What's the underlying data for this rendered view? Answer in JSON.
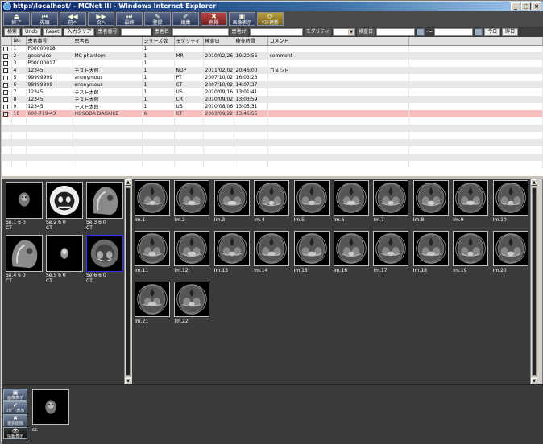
{
  "window": {
    "title": "http://localhost/ - MCNet III - Windows Internet Explorer",
    "min": "_",
    "max": "□",
    "close": "×"
  },
  "toolbar": [
    {
      "label": "終了",
      "icon": "⏏"
    },
    {
      "label": "先頭",
      "icon": "⏮"
    },
    {
      "label": "前へ",
      "icon": "◀◀"
    },
    {
      "label": "次へ",
      "icon": "▶▶"
    },
    {
      "label": "最終",
      "icon": "⏭"
    },
    {
      "label": "登録",
      "icon": "✎"
    },
    {
      "label": "編集",
      "icon": "✐"
    },
    {
      "label": "削除",
      "icon": "✖"
    },
    {
      "label": "画像表示",
      "icon": "▣"
    },
    {
      "label": "ﾘｽﾄ更新",
      "icon": "⟳"
    }
  ],
  "search": {
    "search_btn": "検索",
    "undo_btn": "Undo",
    "reset_btn": "Reset",
    "clear_btn": "入力クリア",
    "patient_id_label": "患者番号",
    "patient_name_label": "患者名",
    "patient_kana_label": "患者ｶﾅ",
    "modality_label": "モダリティ",
    "date_label": "検査日",
    "tilde": "〜",
    "today_btn": "今日",
    "yesterday_btn": "昨日"
  },
  "table": {
    "headers": [
      "",
      "No.",
      "患者番号",
      "患者名",
      "シリーズ数",
      "モダリティ",
      "検査日",
      "検査時間",
      "コメント"
    ],
    "rows": [
      {
        "no": "1",
        "id": "P00000018",
        "name": "",
        "series": "1",
        "modality": "",
        "date": "",
        "time": "",
        "comment": "",
        "checked": false
      },
      {
        "no": "2",
        "id": "geservice",
        "name": "MC phantom",
        "series": "1",
        "modality": "MR",
        "date": "2010/02/26",
        "time": "19:20:55",
        "comment": "comment",
        "checked": false
      },
      {
        "no": "3",
        "id": "P00000017",
        "name": "",
        "series": "1",
        "modality": "",
        "date": "",
        "time": "",
        "comment": "",
        "checked": false
      },
      {
        "no": "4",
        "id": "12345",
        "name": "テスト太郎",
        "series": "1",
        "modality": "NDP",
        "date": "2011/02/02",
        "time": "20:46:00",
        "comment": "コメント",
        "checked": false
      },
      {
        "no": "5",
        "id": "99999999",
        "name": "anonymous",
        "series": "1",
        "modality": "PT",
        "date": "2007/10/02",
        "time": "16:03:23",
        "comment": "",
        "checked": false
      },
      {
        "no": "6",
        "id": "99999999",
        "name": "anonymous",
        "series": "1",
        "modality": "CT",
        "date": "2007/10/02",
        "time": "14:07:37",
        "comment": "",
        "checked": false
      },
      {
        "no": "7",
        "id": "12345",
        "name": "テスト太郎",
        "series": "1",
        "modality": "US",
        "date": "2010/09/16",
        "time": "13:01:41",
        "comment": "",
        "checked": false
      },
      {
        "no": "8",
        "id": "12345",
        "name": "テスト太郎",
        "series": "1",
        "modality": "CR",
        "date": "2010/09/02",
        "time": "13:03:59",
        "comment": "",
        "checked": false
      },
      {
        "no": "9",
        "id": "12345",
        "name": "テスト太郎",
        "series": "1",
        "modality": "US",
        "date": "2010/08/06",
        "time": "13:05:31",
        "comment": "",
        "checked": false
      },
      {
        "no": "10",
        "id": "000-719-43",
        "name": "HOSODA DAISUKE",
        "series": "6",
        "modality": "CT",
        "date": "2003/09/22",
        "time": "13:46:56",
        "comment": "",
        "checked": true
      }
    ]
  },
  "series": [
    {
      "label": "Se.1 6 0",
      "mod": "CT"
    },
    {
      "label": "Se.2 6 0",
      "mod": "CT"
    },
    {
      "label": "Se.3 6 0",
      "mod": "CT"
    },
    {
      "label": "Se.4 6 0",
      "mod": "CT"
    },
    {
      "label": "Se.5 6 0",
      "mod": "CT"
    },
    {
      "label": "Se.6 6 0",
      "mod": "CT"
    }
  ],
  "images": [
    "Im.1",
    "Im.2",
    "Im.3",
    "Im.4",
    "Im.5",
    "Im.6",
    "Im.7",
    "Im.8",
    "Im.9",
    "Im.10",
    "Im.11",
    "Im.12",
    "Im.13",
    "Im.14",
    "Im.15",
    "Im.16",
    "Im.17",
    "Im.18",
    "Im.19",
    "Im.20",
    "Im.21",
    "Im.22"
  ],
  "bottom": {
    "side_buttons": [
      {
        "label": "画像表示",
        "icon": "▣"
      },
      {
        "label": "ｽﾀﾃﾞｨ表示",
        "icon": "✔"
      },
      {
        "label": "選択削除",
        "icon": "✖"
      },
      {
        "label": "情報表示",
        "icon": "👁"
      }
    ],
    "study_label": "st."
  }
}
